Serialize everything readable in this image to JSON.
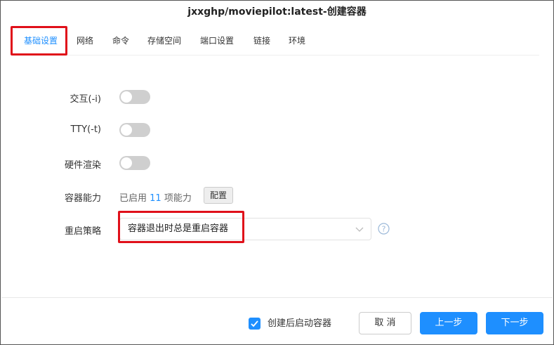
{
  "dialog": {
    "title": "jxxghp/moviepilot:latest-创建容器"
  },
  "tabs": [
    {
      "label": "基础设置",
      "active": true
    },
    {
      "label": "网络"
    },
    {
      "label": "命令"
    },
    {
      "label": "存储空间"
    },
    {
      "label": "端口设置"
    },
    {
      "label": "链接"
    },
    {
      "label": "环境"
    }
  ],
  "form": {
    "interactive_label": "交互(-i)",
    "interactive_on": false,
    "tty_label": "TTY(-t)",
    "tty_on": false,
    "hw_render_label": "硬件渲染",
    "hw_render_on": false,
    "capabilities_label": "容器能力",
    "capabilities_prefix": "已启用",
    "capabilities_count": "11",
    "capabilities_suffix": "项能力",
    "capabilities_button": "配置",
    "restart_label": "重启策略",
    "restart_value": "容器退出时总是重启容器"
  },
  "footer": {
    "start_after_create_label": "创建后启动容器",
    "start_after_create_checked": true,
    "cancel_label": "取 消",
    "prev_label": "上一步",
    "next_label": "下一步"
  },
  "colors": {
    "accent": "#1e8fff",
    "highlight": "#e0101a",
    "toggle_off": "#cfcfcf"
  },
  "icons": [
    "chevron-down-icon",
    "help-circle-icon",
    "check-icon"
  ]
}
